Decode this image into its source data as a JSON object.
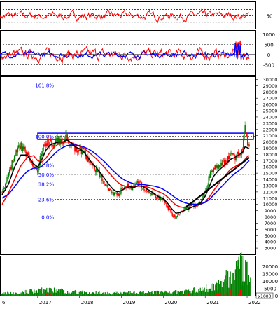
{
  "chart_data": [
    {
      "panel": "rsi",
      "type": "line",
      "y_ticks": [
        50
      ],
      "reference_lines": [
        30,
        50,
        70
      ],
      "ylim": [
        10,
        95
      ],
      "series": [
        {
          "color": "#ff0000"
        }
      ]
    },
    {
      "panel": "oscillator",
      "type": "line",
      "y_ticks": [
        1000,
        500,
        0,
        -500
      ],
      "y_tick_labels": [
        "1000",
        "500",
        "0",
        "-500"
      ],
      "ylim": [
        -1000,
        1200
      ],
      "series": [
        {
          "color": "#ff0000"
        },
        {
          "color": "#0000ff"
        }
      ]
    },
    {
      "panel": "price",
      "type": "candlestick",
      "y_ticks": [
        3000,
        4000,
        5000,
        6000,
        7000,
        8000,
        9000,
        10000,
        11000,
        12000,
        13000,
        14000,
        15000,
        16000,
        17000,
        18000,
        19000,
        20000,
        21000,
        22000,
        23000,
        24000,
        25000,
        26000,
        27000,
        28000,
        29000,
        30000
      ],
      "ylim": [
        2000,
        30500
      ],
      "x_tick_labels": [
        "6",
        "2017",
        "2018",
        "2019",
        "2020",
        "2021",
        "2022"
      ],
      "x_values": [
        2016.9,
        2017.0,
        2018.0,
        2019.0,
        2020.0,
        2021.0,
        2022.0
      ],
      "xlim": [
        2016.1,
        2022.2
      ],
      "fibonacci": {
        "levels": [
          {
            "label": "161.8%",
            "price": 29100
          },
          {
            "label": "100.0%",
            "price": 20900
          },
          {
            "label": "61.8%",
            "price": 16300
          },
          {
            "label": "50.0%",
            "price": 14800
          },
          {
            "label": "38.2%",
            "price": 13300
          },
          {
            "label": "23.6%",
            "price": 10800
          },
          {
            "label": "0.0%",
            "price": 8000
          }
        ],
        "label_color": "#0000ff",
        "line_color": "#000000"
      },
      "resistance_box": {
        "price_low": 20400,
        "price_high": 21400,
        "color": "#0000ff"
      },
      "trendline": {
        "from": [
          2020.55,
          9600
        ],
        "to": [
          2022.05,
          17500
        ],
        "color": "#000000"
      },
      "price_series": {
        "x": [
          2016.15,
          2016.3,
          2016.45,
          2016.6,
          2016.75,
          2016.9,
          2017.0,
          2017.1,
          2017.2,
          2017.3,
          2017.4,
          2017.5,
          2017.6,
          2017.7,
          2017.8,
          2017.9,
          2018.0,
          2018.1,
          2018.2,
          2018.3,
          2018.4,
          2018.5,
          2018.6,
          2018.7,
          2018.8,
          2018.9,
          2019.0,
          2019.1,
          2019.2,
          2019.3,
          2019.4,
          2019.5,
          2019.6,
          2019.7,
          2019.8,
          2019.9,
          2020.0,
          2020.1,
          2020.2,
          2020.3,
          2020.4,
          2020.5,
          2020.6,
          2020.7,
          2020.8,
          2020.9,
          2021.0,
          2021.1,
          2021.2,
          2021.3,
          2021.4,
          2021.5,
          2021.6,
          2021.7,
          2021.8,
          2021.9,
          2021.95,
          2022.0,
          2022.05
        ],
        "close": [
          12000,
          14500,
          18000,
          19300,
          18000,
          16000,
          15500,
          18500,
          19700,
          20100,
          19800,
          20300,
          19800,
          20900,
          19500,
          18500,
          19000,
          18300,
          17000,
          16000,
          15500,
          14500,
          13500,
          12500,
          11700,
          11500,
          12200,
          13000,
          12800,
          12600,
          13600,
          12800,
          12200,
          11800,
          11200,
          11000,
          10800,
          9500,
          8500,
          7800,
          8600,
          9100,
          9500,
          9800,
          10000,
          10500,
          12000,
          14500,
          16000,
          15800,
          16500,
          17000,
          18000,
          17500,
          18200,
          19000,
          23200,
          20000,
          19500
        ]
      },
      "moving_averages": [
        {
          "color": "#ff0000",
          "values": [
            10000,
            11800,
            14000,
            16200,
            17500,
            17800,
            17000,
            16800,
            17400,
            18400,
            19200,
            19700,
            19900,
            20000,
            19900,
            19600,
            19300,
            19000,
            18500,
            17900,
            17300,
            16600,
            15900,
            15100,
            14300,
            13600,
            13100,
            12900,
            12800,
            12800,
            12900,
            12900,
            12800,
            12600,
            12300,
            12000,
            11700,
            11200,
            10500,
            9900,
            9600,
            9500,
            9500,
            9600,
            9800,
            10000,
            10400,
            11200,
            12200,
            13100,
            14000,
            14800,
            15600,
            16000,
            16400,
            16800,
            17200,
            17600,
            17800
          ]
        },
        {
          "color": "#0000ff",
          "values": [
            11000,
            11600,
            12800,
            14200,
            15300,
            15800,
            15800,
            16100,
            16700,
            17400,
            18100,
            18700,
            19100,
            19400,
            19500,
            19500,
            19400,
            19200,
            18900,
            18500,
            18000,
            17400,
            16800,
            16100,
            15400,
            14800,
            14200,
            13800,
            13500,
            13300,
            13200,
            13200,
            13100,
            13000,
            12900,
            12700,
            12400,
            12000,
            11500,
            11000,
            10600,
            10300,
            10100,
            10000,
            10000,
            10100,
            10300,
            10800,
            11500,
            12200,
            12900,
            13600,
            14300,
            14900,
            15400,
            15900,
            16300,
            16700,
            17000
          ]
        },
        {
          "color": "#000000",
          "values": [
            11500,
            13200,
            16000,
            17900,
            17900,
            16500,
            16000,
            17200,
            18700,
            19500,
            19800,
            20000,
            20000,
            20300,
            19900,
            19200,
            18900,
            18400,
            17500,
            16600,
            15900,
            15000,
            14100,
            13200,
            12400,
            12000,
            12200,
            12600,
            12800,
            12700,
            13000,
            12900,
            12500,
            12100,
            11600,
            11200,
            10900,
            10200,
            9300,
            8600,
            8700,
            9000,
            9300,
            9600,
            9900,
            10300,
            11300,
            12900,
            14500,
            15300,
            15900,
            16500,
            17200,
            17500,
            17900,
            18400,
            19200,
            19100,
            18900
          ]
        }
      ]
    },
    {
      "panel": "volume",
      "type": "bar",
      "y_ticks": [
        5000,
        10000,
        15000,
        20000
      ],
      "ylim": [
        0,
        27000
      ],
      "unit_label": "x1000",
      "zero_label": "0",
      "bar_color": "#008000",
      "bars": [
        {
          "x": [
            2016.1,
            2016.5,
            2016.9,
            2017.3,
            2017.7,
            2018.1,
            2018.5,
            2018.9,
            2019.3,
            2019.7,
            2020.1,
            2020.5,
            2020.9,
            2021.3,
            2021.5,
            2021.7,
            2021.8,
            2021.9,
            2022.0,
            2022.1
          ]
        },
        {
          "v": [
            1500,
            2000,
            3500,
            4000,
            3000,
            2500,
            2000,
            1800,
            2000,
            2200,
            2500,
            3500,
            4500,
            8000,
            12000,
            15000,
            19000,
            22000,
            16000,
            7000
          ]
        }
      ]
    }
  ]
}
